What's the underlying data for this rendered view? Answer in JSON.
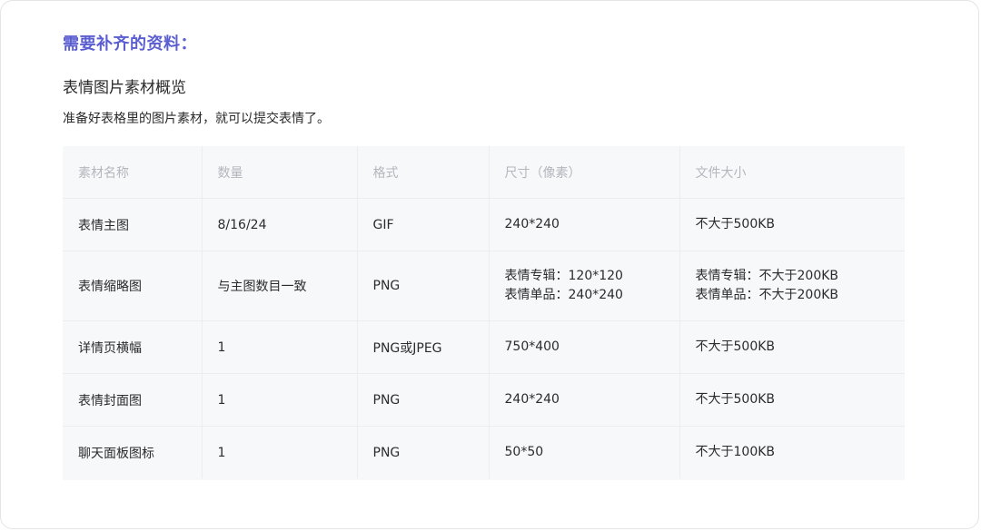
{
  "section_title": "需要补齐的资料：",
  "subtitle": "表情图片素材概览",
  "description": "准备好表格里的图片素材，就可以提交表情了。",
  "table": {
    "headers": [
      "素材名称",
      "数量",
      "格式",
      "尺寸（像素）",
      "文件大小"
    ],
    "rows": [
      {
        "name": "表情主图",
        "count": "8/16/24",
        "format": "GIF",
        "size": [
          "240*240"
        ],
        "filesize": [
          "不大于500KB"
        ]
      },
      {
        "name": "表情缩略图",
        "count": "与主图数目一致",
        "format": "PNG",
        "size": [
          "表情专辑：120*120",
          "表情单品：240*240"
        ],
        "filesize": [
          "表情专辑：不大于200KB",
          "表情单品：不大于200KB"
        ]
      },
      {
        "name": "详情页横幅",
        "count": "1",
        "format": "PNG或JPEG",
        "size": [
          "750*400"
        ],
        "filesize": [
          "不大于500KB"
        ]
      },
      {
        "name": "表情封面图",
        "count": "1",
        "format": "PNG",
        "size": [
          "240*240"
        ],
        "filesize": [
          "不大于500KB"
        ]
      },
      {
        "name": "聊天面板图标",
        "count": "1",
        "format": "PNG",
        "size": [
          "50*50"
        ],
        "filesize": [
          "不大于100KB"
        ]
      }
    ]
  },
  "colors": {
    "accent": "#5b5ed1",
    "table_bg": "#f7f8fa",
    "header_text": "#b3b6bc"
  }
}
